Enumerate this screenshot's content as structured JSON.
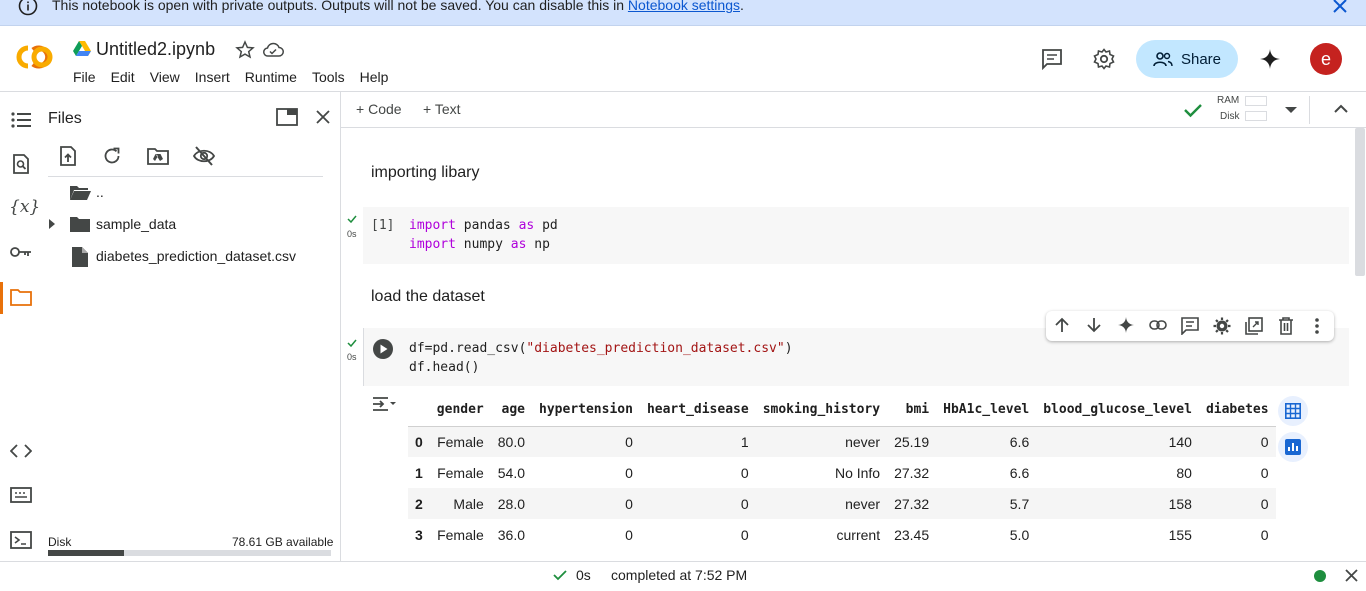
{
  "banner": {
    "text": "This notebook is open with private outputs. Outputs will not be saved. You can disable this in ",
    "link": "Notebook settings",
    "suffix": "."
  },
  "header": {
    "logo_text": "CO",
    "title": "Untitled2.ipynb",
    "menu": [
      "File",
      "Edit",
      "View",
      "Insert",
      "Runtime",
      "Tools",
      "Help"
    ],
    "share_label": "Share",
    "avatar_letter": "e"
  },
  "sidebar": {
    "title": "Files",
    "tree": [
      {
        "label": "..",
        "type": "parent-folder"
      },
      {
        "label": "sample_data",
        "type": "folder"
      },
      {
        "label": "diabetes_prediction_dataset.csv",
        "type": "file"
      }
    ],
    "disk_label": "Disk",
    "disk_available": "78.61 GB available",
    "disk_used_fraction": 0.27
  },
  "toolbar": {
    "add_code": "Code",
    "add_text": "Text",
    "ram_label": "RAM",
    "disk_label": "Disk"
  },
  "notebook": {
    "md1": "importing libary",
    "cell1": {
      "exec_count": "[1]",
      "time": "0s",
      "line1": {
        "kw1": "import",
        "mod": " pandas ",
        "kw2": "as",
        "alias": " pd"
      },
      "line2": {
        "kw1": "import",
        "mod": " numpy ",
        "kw2": "as",
        "alias": " np"
      }
    },
    "md2": "load the dataset",
    "cell2": {
      "time": "0s",
      "line1_pre": "df=pd.read_csv(",
      "line1_str": "\"diabetes_prediction_dataset.csv\"",
      "line1_post": ")",
      "line2": "df.head()"
    },
    "table": {
      "columns": [
        "",
        "gender",
        "age",
        "hypertension",
        "heart_disease",
        "smoking_history",
        "bmi",
        "HbA1c_level",
        "blood_glucose_level",
        "diabetes"
      ],
      "rows": [
        [
          "0",
          "Female",
          "80.0",
          "0",
          "1",
          "never",
          "25.19",
          "6.6",
          "140",
          "0"
        ],
        [
          "1",
          "Female",
          "54.0",
          "0",
          "0",
          "No Info",
          "27.32",
          "6.6",
          "80",
          "0"
        ],
        [
          "2",
          "Male",
          "28.0",
          "0",
          "0",
          "never",
          "27.32",
          "5.7",
          "158",
          "0"
        ],
        [
          "3",
          "Female",
          "36.0",
          "0",
          "0",
          "current",
          "23.45",
          "5.0",
          "155",
          "0"
        ]
      ]
    }
  },
  "status": {
    "time": "0s",
    "text": "completed at 7:52 PM"
  },
  "colors": {
    "banner_bg": "#d3e3fd",
    "share_bg": "#c2e7ff",
    "accent_orange": "#f9ab00",
    "avatar_bg": "#c5221f",
    "check_green": "#1e8e3e"
  }
}
